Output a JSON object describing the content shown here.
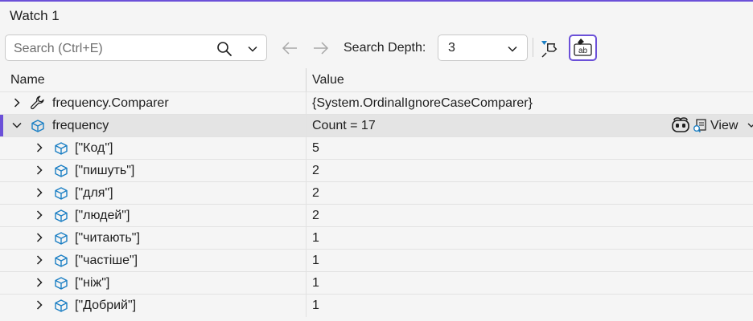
{
  "window": {
    "title": "Watch 1"
  },
  "toolbar": {
    "search_placeholder": "Search (Ctrl+E)",
    "search_depth_label": "Search Depth:",
    "search_depth_value": "3",
    "icons": {
      "search": "search-icon",
      "dropdown": "chevron-down-icon",
      "back": "arrow-left-icon",
      "forward": "arrow-right-icon",
      "pin": "pin-icon",
      "raw": "raw-string-icon"
    }
  },
  "columns": {
    "name": "Name",
    "value": "Value"
  },
  "rows": [
    {
      "name": "frequency.Comparer",
      "value": "{System.OrdinalIgnoreCaseComparer}",
      "icon": "wrench-icon",
      "expanded": false
    },
    {
      "name": "frequency",
      "value": "Count = 17",
      "icon": "cube-icon",
      "expanded": true,
      "selected": true,
      "view_label": "View"
    },
    {
      "name": "[\"Код\"]",
      "value": "5",
      "icon": "cube-icon"
    },
    {
      "name": "[\"пишуть\"]",
      "value": "2",
      "icon": "cube-icon"
    },
    {
      "name": "[\"для\"]",
      "value": "2",
      "icon": "cube-icon"
    },
    {
      "name": "[\"людей\"]",
      "value": "2",
      "icon": "cube-icon"
    },
    {
      "name": "[\"читають\"]",
      "value": "1",
      "icon": "cube-icon"
    },
    {
      "name": "[\"частіше\"]",
      "value": "1",
      "icon": "cube-icon"
    },
    {
      "name": "[\"ніж\"]",
      "value": "1",
      "icon": "cube-icon"
    },
    {
      "name": "[\"Добрий\"]",
      "value": "1",
      "icon": "cube-icon"
    }
  ],
  "colors": {
    "accent": "#6b50d8",
    "cube": "#1b7fc4",
    "selected_row": "#e4e4e4",
    "background": "#f5f5f5"
  }
}
